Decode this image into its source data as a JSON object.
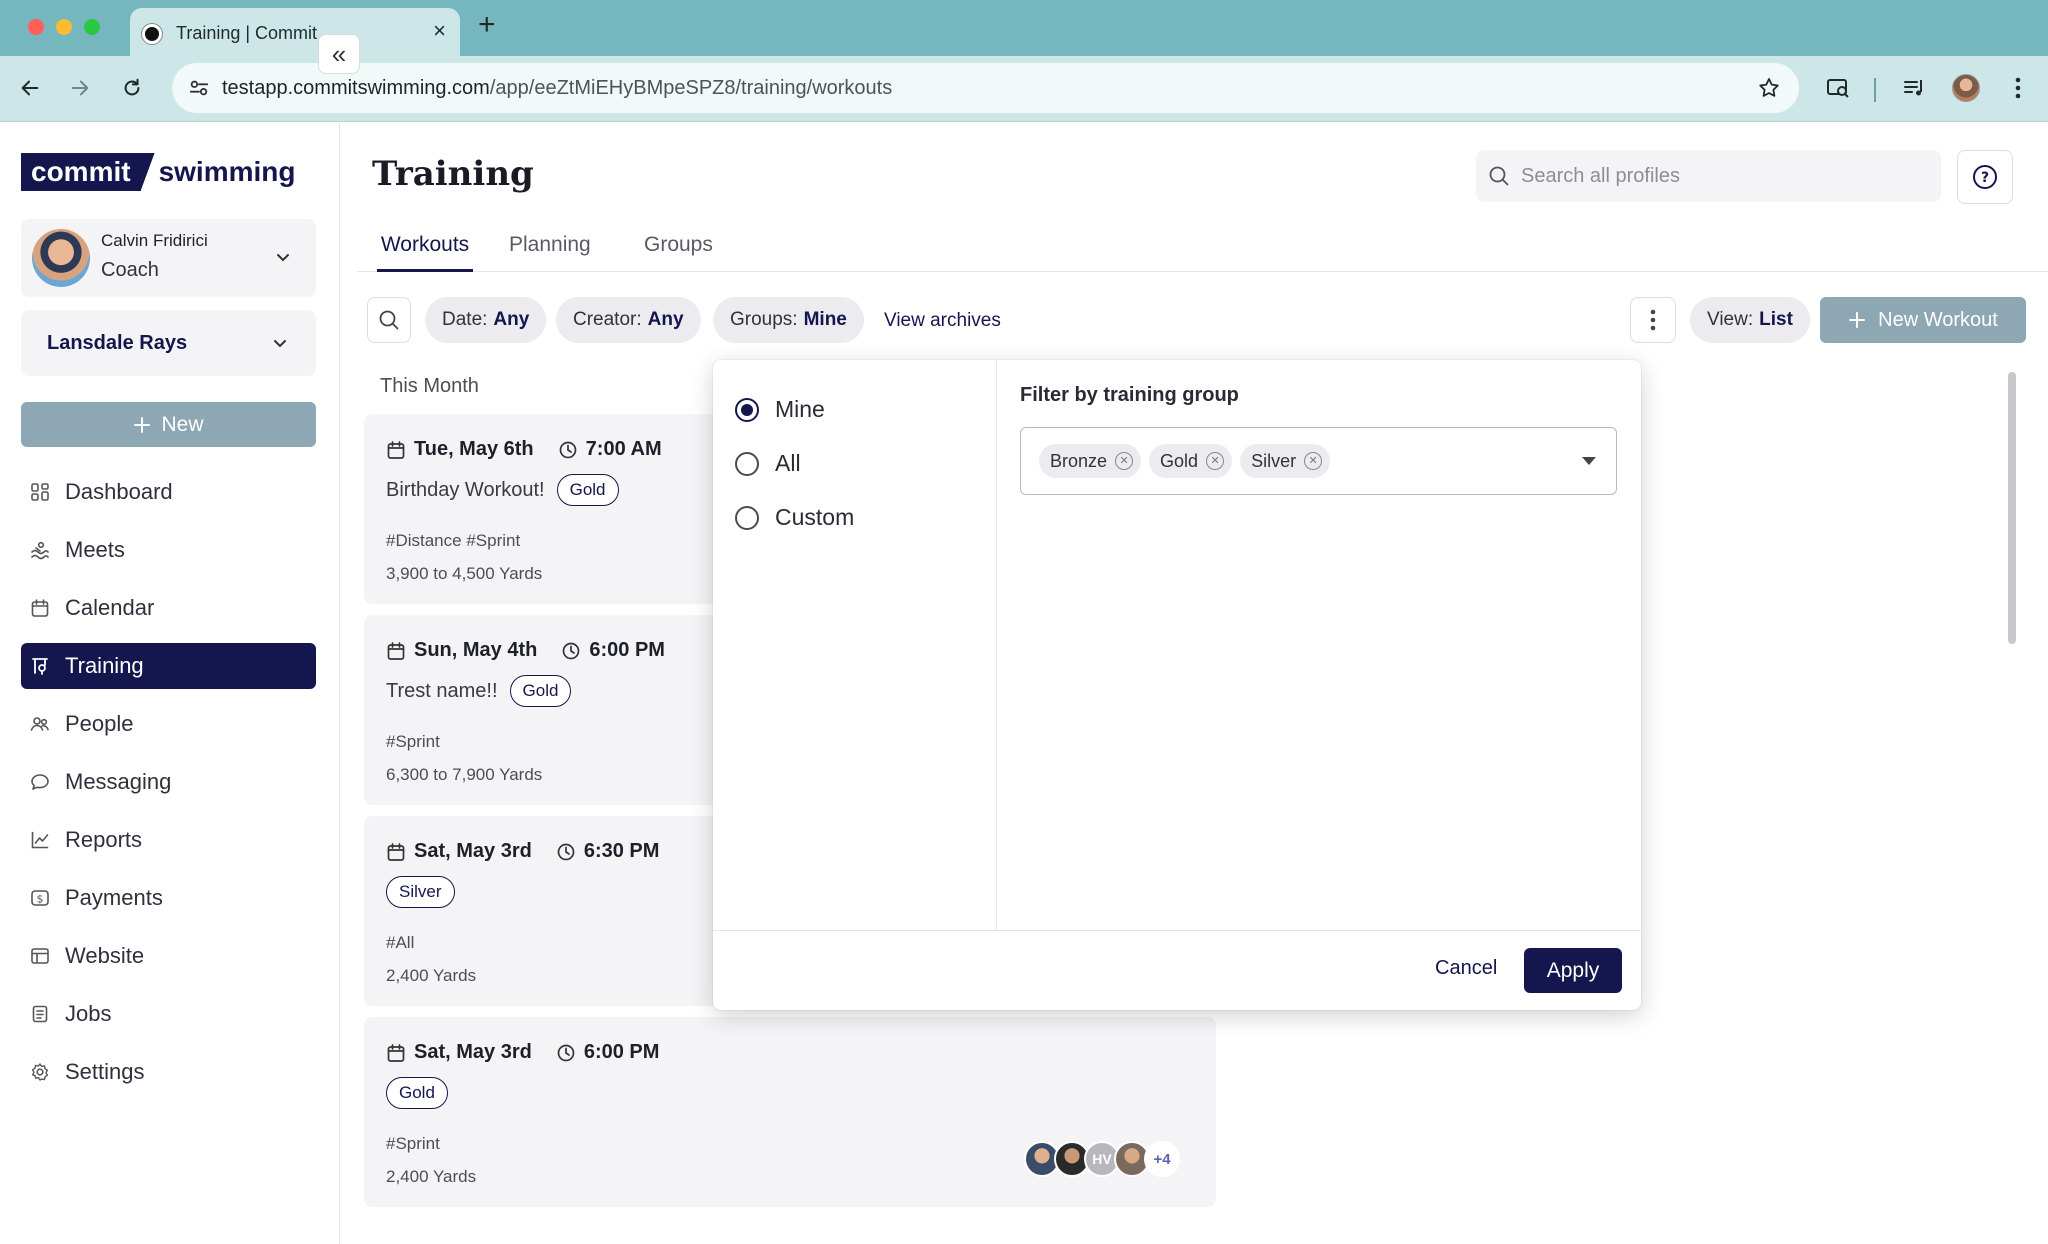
{
  "browser": {
    "tab_title": "Training | Commit",
    "url_host": "testapp.commitswimming.com",
    "url_path": "/app/eeZtMiEHyBMpeSPZ8/training/workouts",
    "traffic_colors": [
      "#ff5f57",
      "#febc2e",
      "#28c840"
    ]
  },
  "logo": {
    "part1": "commit",
    "part2": "swimming"
  },
  "user": {
    "name": "Calvin Fridirici",
    "role": "Coach"
  },
  "team": {
    "name": "Lansdale Rays"
  },
  "sidebar": {
    "new_label": "New",
    "items": [
      {
        "label": "Dashboard",
        "icon": "dashboard-icon"
      },
      {
        "label": "Meets",
        "icon": "meets-icon"
      },
      {
        "label": "Calendar",
        "icon": "calendar-icon"
      },
      {
        "label": "Training",
        "icon": "training-icon",
        "active": true
      },
      {
        "label": "People",
        "icon": "people-icon"
      },
      {
        "label": "Messaging",
        "icon": "messaging-icon"
      },
      {
        "label": "Reports",
        "icon": "reports-icon"
      },
      {
        "label": "Payments",
        "icon": "payments-icon"
      },
      {
        "label": "Website",
        "icon": "website-icon"
      },
      {
        "label": "Jobs",
        "icon": "jobs-icon"
      },
      {
        "label": "Settings",
        "icon": "settings-icon"
      }
    ]
  },
  "header": {
    "title": "Training",
    "search_placeholder": "Search all profiles"
  },
  "tabs": [
    {
      "label": "Workouts",
      "active": true
    },
    {
      "label": "Planning"
    },
    {
      "label": "Groups"
    }
  ],
  "filters": {
    "date": {
      "label": "Date:",
      "value": "Any"
    },
    "creator": {
      "label": "Creator:",
      "value": "Any"
    },
    "groups": {
      "label": "Groups:",
      "value": "Mine"
    },
    "view_archives": "View archives",
    "view": {
      "label": "View:",
      "value": "List"
    },
    "new_workout": "New Workout"
  },
  "section": {
    "heading": "This Month"
  },
  "workouts": [
    {
      "date": "Tue, May 6th",
      "time": "7:00 AM",
      "title": "Birthday Workout!",
      "badge": "Gold",
      "tags": "#Distance #Sprint",
      "yards": "3,900 to 4,500 Yards"
    },
    {
      "date": "Sun, May 4th",
      "time": "6:00 PM",
      "title": "Trest name!!",
      "badge": "Gold",
      "tags": "#Sprint",
      "yards": "6,300 to 7,900 Yards"
    },
    {
      "date": "Sat, May 3rd",
      "time": "6:30 PM",
      "title": "",
      "badge": "Silver",
      "tags": "#All",
      "yards": "2,400 Yards"
    },
    {
      "date": "Sat, May 3rd",
      "time": "6:00 PM",
      "title": "",
      "badge": "Gold",
      "tags": "#Sprint",
      "yards": "2,400 Yards",
      "avatars": {
        "initials": "HV",
        "more": "+4"
      }
    }
  ],
  "popover": {
    "options": [
      "Mine",
      "All",
      "Custom"
    ],
    "selected": "Mine",
    "heading": "Filter by training group",
    "groups": [
      "Bronze",
      "Gold",
      "Silver"
    ],
    "cancel": "Cancel",
    "apply": "Apply"
  },
  "colors": {
    "brand_navy": "#14164d",
    "disabled_button": "#8ea7b4",
    "chrome_teal": "#76b7bf"
  }
}
